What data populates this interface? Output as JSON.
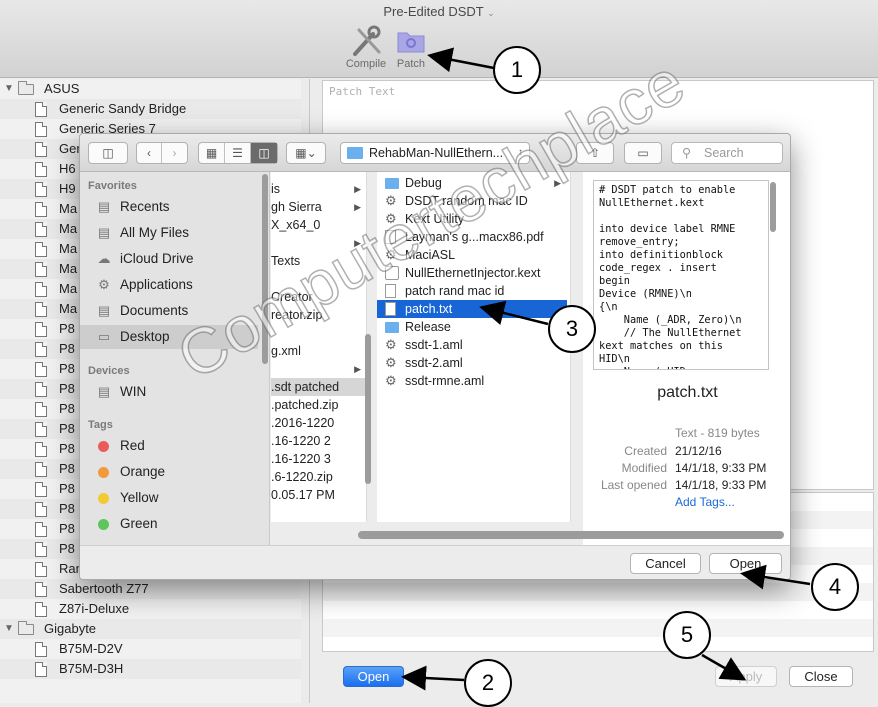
{
  "window": {
    "title": "Pre-Edited DSDT"
  },
  "toolbar": {
    "compile_label": "Compile",
    "patch_label": "Patch"
  },
  "sidebar": {
    "groups": [
      {
        "label": "ASUS",
        "items": [
          "Generic Sandy Bridge",
          "Generic Series 7",
          "Generic",
          "H6",
          "H9",
          "Ma",
          "Ma",
          "Ma",
          "Ma",
          "Ma",
          "Ma",
          "P8",
          "P8",
          "P8",
          "P8",
          "P8",
          "P8",
          "P8",
          "P8",
          "P8",
          "P8",
          "P8",
          "P8",
          "Rampage II Extreme",
          "Sabertooth Z77",
          "Z87i-Deluxe"
        ]
      },
      {
        "label": "Gigabyte",
        "items": [
          "B75M-D2V",
          "B75M-D3H"
        ]
      }
    ]
  },
  "editor": {
    "placeholder": "Patch Text"
  },
  "bottom": {
    "open_label": "Open",
    "apply_label": "Apply",
    "close_label": "Close"
  },
  "dialog": {
    "path": "RehabMan-NullEthern...",
    "search_placeholder": "Search",
    "favorites_header": "Favorites",
    "favorites": [
      "Recents",
      "All My Files",
      "iCloud Drive",
      "Applications",
      "Documents",
      "Desktop"
    ],
    "devices_header": "Devices",
    "devices": [
      "WIN"
    ],
    "tags_header": "Tags",
    "tags": [
      {
        "label": "Red",
        "color": "#ec5b5b"
      },
      {
        "label": "Orange",
        "color": "#f19a3d"
      },
      {
        "label": "Yellow",
        "color": "#f2cb33"
      },
      {
        "label": "Green",
        "color": "#5cc55c"
      }
    ],
    "col1": [
      "is",
      "gh Sierra",
      "X_x64_0",
      "",
      "Texts",
      "",
      "Creator",
      "reator.zip",
      "",
      "g.xml",
      "",
      ".sdt patched",
      ".patched.zip",
      ".2016-1220",
      ".16-1220 2",
      ".16-1220 3",
      ".6-1220.zip",
      "0.05.17 PM"
    ],
    "col2": [
      "Debug",
      "DSDT random mac ID",
      "Kext Utility",
      "Layman's g...macx86.pdf",
      "MaciASL",
      "NullEthernetInjector.kext",
      "patch rand mac id",
      "patch.txt",
      "Release",
      "ssdt-1.aml",
      "ssdt-2.aml",
      "ssdt-rmne.aml"
    ],
    "preview": {
      "text": "# DSDT patch to enable\nNullEthernet.kext\n\ninto device label RMNE\nremove_entry;\ninto definitionblock\ncode_regex . insert\nbegin\nDevice (RMNE)\\n\n{\\n\n    Name (_ADR, Zero)\\n\n    // The NullEthernet\nkext matches on this\nHID\\n\n    Name (_HID",
      "filename": "patch.txt",
      "kind": "Text - 819 bytes",
      "created_label": "Created",
      "created": "21/12/16",
      "modified_label": "Modified",
      "modified": "14/1/18, 9:33 PM",
      "opened_label": "Last opened",
      "opened": "14/1/18, 9:33 PM",
      "add_tags": "Add Tags..."
    },
    "cancel_label": "Cancel",
    "open_label": "Open"
  },
  "callouts": [
    "1",
    "2",
    "3",
    "4",
    "5"
  ],
  "watermark": "Computertechplace"
}
